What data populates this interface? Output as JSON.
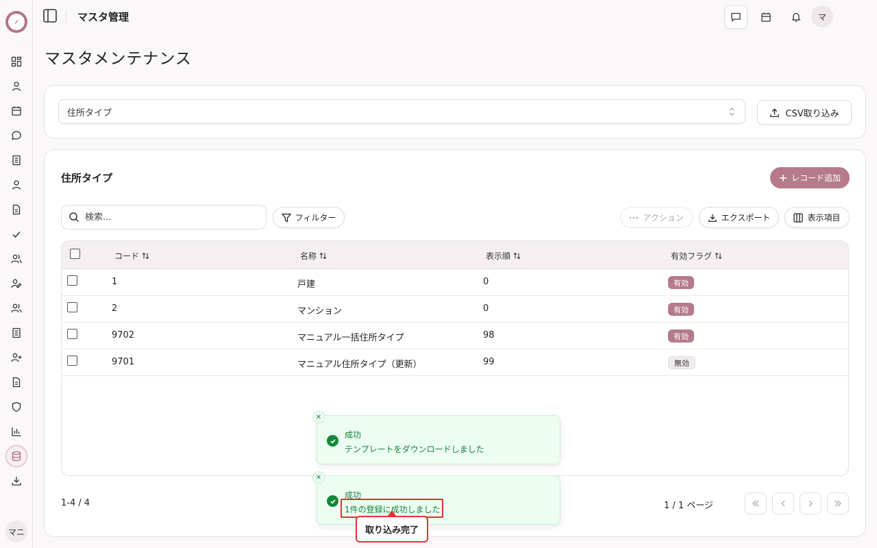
{
  "header": {
    "title": "マスタ管理",
    "avatar": "マ"
  },
  "sidebar": {
    "user_chip": "マニ"
  },
  "page": {
    "title": "マスタメンテナンス"
  },
  "master_select": {
    "value": "住所タイプ"
  },
  "csv_import_label": "CSV取り込み",
  "section": {
    "title": "住所タイプ",
    "add_record_label": "レコード追加",
    "search_placeholder": "検索...",
    "filter_label": "フィルター",
    "action_label": "アクション",
    "export_label": "エクスポート",
    "columns_label": "表示項目"
  },
  "table": {
    "columns": [
      "コード",
      "名称",
      "表示順",
      "有効フラグ"
    ],
    "rows": [
      {
        "code": "1",
        "name": "戸建",
        "order": "0",
        "flag": "有効",
        "active": true
      },
      {
        "code": "2",
        "name": "マンション",
        "order": "0",
        "flag": "有効",
        "active": true
      },
      {
        "code": "9702",
        "name": "マニュアル一括住所タイプ",
        "order": "98",
        "flag": "有効",
        "active": true
      },
      {
        "code": "9701",
        "name": "マニュアル住所タイプ（更新）",
        "order": "99",
        "flag": "無効",
        "active": false
      }
    ]
  },
  "pagination": {
    "count_text": "1-4 / 4",
    "page_text": "1 / 1 ページ"
  },
  "toasts": [
    {
      "title": "成功",
      "message": "テンプレートをダウンロードしました"
    },
    {
      "title": "成功",
      "message": "1件の登録に成功しました"
    }
  ],
  "callout": "取り込み完了",
  "colors": {
    "accent": "#b57b8b",
    "success": "#15803d",
    "highlight": "#e03131"
  }
}
